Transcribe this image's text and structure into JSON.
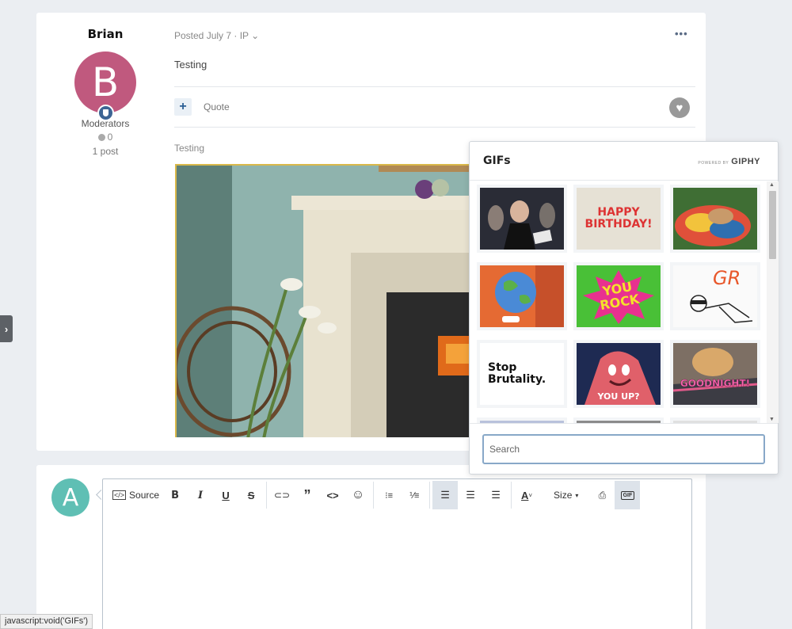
{
  "post": {
    "author_name": "Brian",
    "avatar_letter": "B",
    "group": "Moderators",
    "reputation": "0",
    "post_count": "1 post",
    "meta": "Posted July 7 · IP",
    "menu_glyph": "•••",
    "content": "Testing",
    "quote_label": "Quote",
    "quoted_text": "Testing"
  },
  "reply": {
    "avatar_letter": "A"
  },
  "editor_toolbar": {
    "source_label": "Source",
    "bold": "B",
    "italic": "I",
    "underline": "U",
    "strike": "S",
    "link_glyph": "🔗",
    "quote_glyph": "❞",
    "code_glyph": "<>",
    "emoji_glyph": "☺",
    "size_label": "Size",
    "gif_label": "GIF"
  },
  "gif_panel": {
    "title": "GIFs",
    "powered_by": "POWERED BY",
    "brand": "GIPHY",
    "search_placeholder": "Search",
    "tiles": [
      {
        "caption": ""
      },
      {
        "caption": "HAPPY\nBIRTHDAY!"
      },
      {
        "caption": ""
      },
      {
        "caption": ""
      },
      {
        "caption": "YOU\nROCK"
      },
      {
        "caption": "GR"
      },
      {
        "caption": "Stop\nBrutality."
      },
      {
        "caption": "YOU UP?"
      },
      {
        "caption": "GOODNIGHT!"
      }
    ]
  },
  "status_bar": {
    "text": "javascript:void('GIFs')"
  },
  "colors": {
    "page_bg": "#ebeef2",
    "author_avatar": "#c0597e",
    "reply_avatar": "#5fbfb4",
    "link_blue": "#2a5e94",
    "focus_border": "#88a8c8"
  }
}
